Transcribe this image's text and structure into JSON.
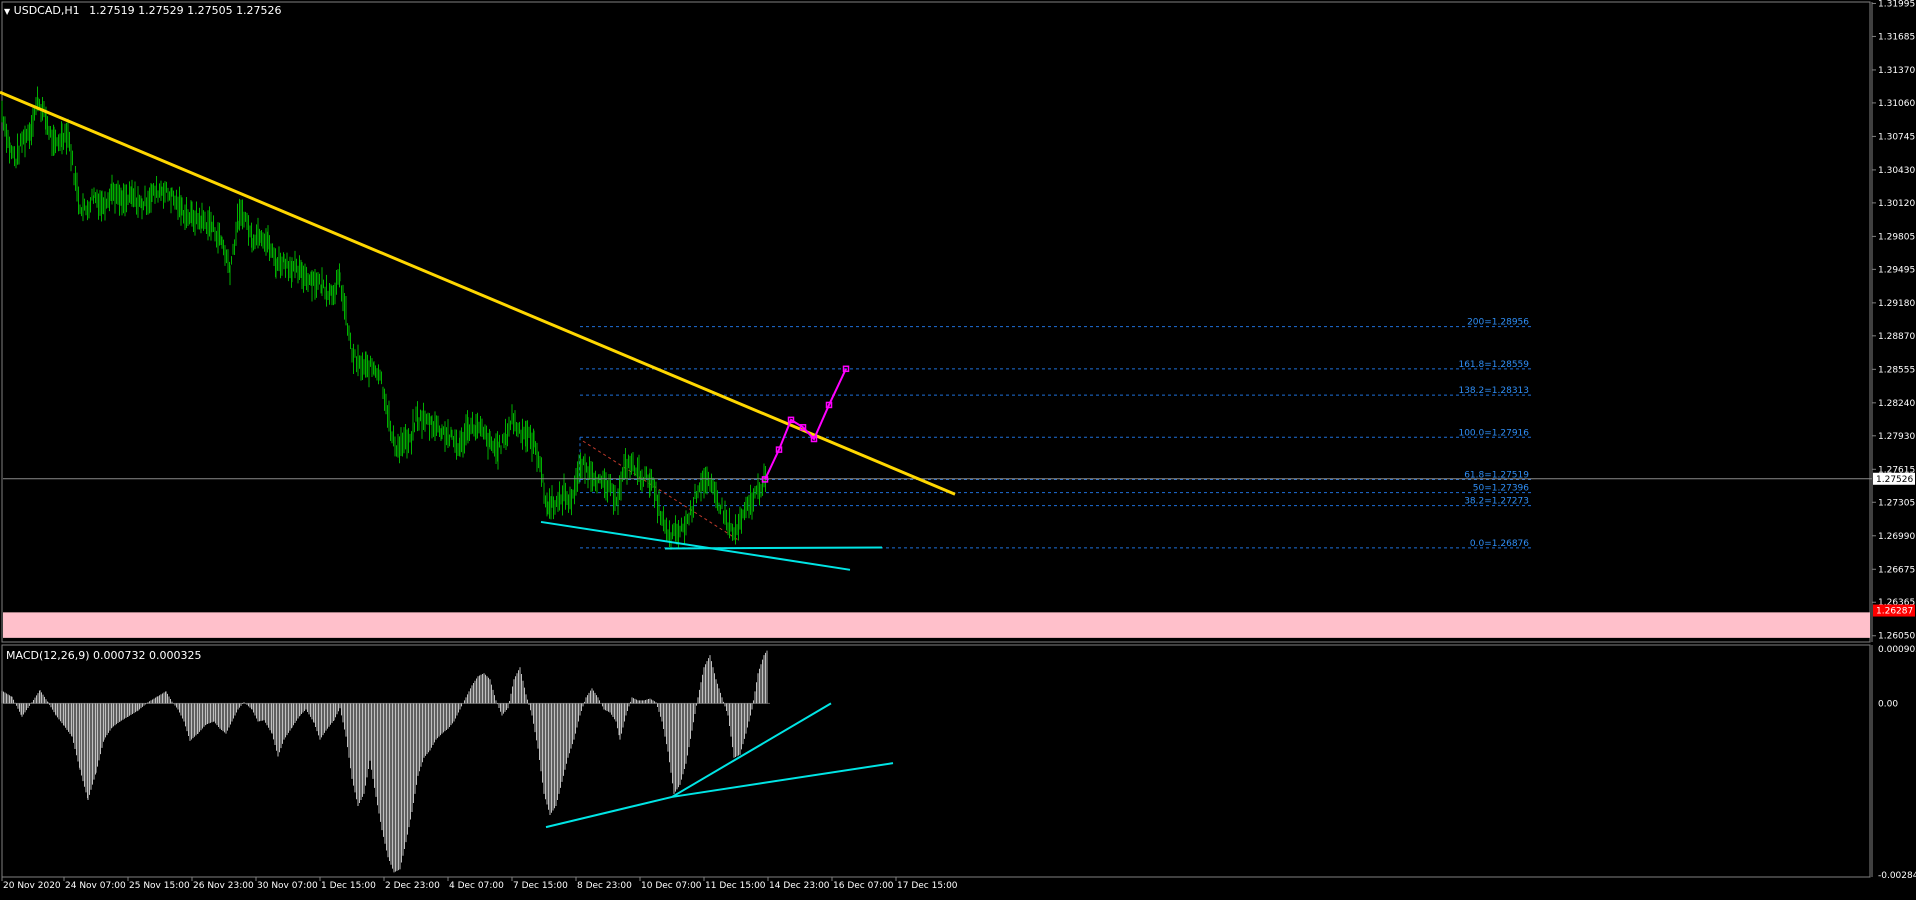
{
  "header": {
    "symbol": "USDCAD,H1",
    "ohlc": "1.27519 1.27529 1.27505 1.27526"
  },
  "macd_header": {
    "label": "MACD(12,26,9) 0.000732 0.000325"
  },
  "colors": {
    "background": "#000000",
    "candles": "#00b000",
    "trendline": "#ffd700",
    "support_lines": "#00e5e5",
    "fib_lines": "#1e6fd9",
    "fib_labels": "#2f8ef5",
    "projection": "#ff00ff",
    "zone": "#ffc0cb",
    "histogram": "#c0c0c0",
    "price_box_current": "#ffffff",
    "price_box_zone": "#ff0000"
  },
  "chart_data": [
    {
      "type": "candlestick",
      "title": "USDCAD,H1",
      "ylim": [
        1.2601,
        1.3199
      ],
      "price_ticks": [
        "1.31995",
        "1.31685",
        "1.31370",
        "1.31060",
        "1.30745",
        "1.30430",
        "1.30120",
        "1.29805",
        "1.29495",
        "1.29180",
        "1.28870",
        "1.28555",
        "1.28240",
        "1.27930",
        "1.27615",
        "1.27305",
        "1.26990",
        "1.26675",
        "1.26365",
        "1.26050"
      ],
      "current_price": "1.27526",
      "zone_price": "1.26287",
      "x_labels": [
        "20 Nov 2020",
        "24 Nov 07:00",
        "25 Nov 15:00",
        "26 Nov 23:00",
        "30 Nov 07:00",
        "1 Dec 15:00",
        "2 Dec 23:00",
        "4 Dec 07:00",
        "7 Dec 15:00",
        "8 Dec 23:00",
        "10 Dec 07:00",
        "11 Dec 15:00",
        "14 Dec 23:00",
        "16 Dec 07:00",
        "17 Dec 15:00"
      ],
      "price_path": [
        [
          0,
          1.3098
        ],
        [
          8,
          1.3062
        ],
        [
          14,
          1.3053
        ],
        [
          20,
          1.307
        ],
        [
          28,
          1.308
        ],
        [
          36,
          1.3109
        ],
        [
          44,
          1.309
        ],
        [
          52,
          1.3065
        ],
        [
          60,
          1.3075
        ],
        [
          66,
          1.3078
        ],
        [
          72,
          1.304
        ],
        [
          78,
          1.301
        ],
        [
          84,
          1.3005
        ],
        [
          92,
          1.302
        ],
        [
          100,
          1.301
        ],
        [
          110,
          1.3024
        ],
        [
          120,
          1.3012
        ],
        [
          130,
          1.3018
        ],
        [
          140,
          1.301
        ],
        [
          150,
          1.302
        ],
        [
          160,
          1.3025
        ],
        [
          170,
          1.3018
        ],
        [
          180,
          1.3005
        ],
        [
          190,
          1.2998
        ],
        [
          200,
          1.2996
        ],
        [
          210,
          1.299
        ],
        [
          220,
          1.2975
        ],
        [
          228,
          1.295
        ],
        [
          236,
          1.2995
        ],
        [
          242,
          1.3002
        ],
        [
          250,
          1.2978
        ],
        [
          258,
          1.2985
        ],
        [
          266,
          1.2975
        ],
        [
          274,
          1.2955
        ],
        [
          282,
          1.2958
        ],
        [
          290,
          1.295
        ],
        [
          300,
          1.2945
        ],
        [
          310,
          1.294
        ],
        [
          320,
          1.2935
        ],
        [
          330,
          1.2928
        ],
        [
          338,
          1.294
        ],
        [
          344,
          1.2905
        ],
        [
          350,
          1.287
        ],
        [
          356,
          1.286
        ],
        [
          364,
          1.2856
        ],
        [
          372,
          1.2858
        ],
        [
          378,
          1.2852
        ],
        [
          384,
          1.2825
        ],
        [
          390,
          1.279
        ],
        [
          396,
          1.2782
        ],
        [
          402,
          1.2788
        ],
        [
          408,
          1.2785
        ],
        [
          414,
          1.281
        ],
        [
          420,
          1.2808
        ],
        [
          430,
          1.2805
        ],
        [
          440,
          1.2798
        ],
        [
          450,
          1.279
        ],
        [
          458,
          1.2782
        ],
        [
          466,
          1.2802
        ],
        [
          474,
          1.28
        ],
        [
          480,
          1.2797
        ],
        [
          488,
          1.2785
        ],
        [
          496,
          1.278
        ],
        [
          504,
          1.2792
        ],
        [
          510,
          1.281
        ],
        [
          516,
          1.28
        ],
        [
          524,
          1.2795
        ],
        [
          532,
          1.2785
        ],
        [
          538,
          1.277
        ],
        [
          542,
          1.274
        ],
        [
          546,
          1.2725
        ],
        [
          550,
          1.2732
        ],
        [
          556,
          1.2728
        ],
        [
          562,
          1.274
        ],
        [
          568,
          1.273
        ],
        [
          574,
          1.275
        ],
        [
          580,
          1.2765
        ],
        [
          586,
          1.276
        ],
        [
          592,
          1.2757
        ],
        [
          598,
          1.2748
        ],
        [
          604,
          1.2745
        ],
        [
          610,
          1.274
        ],
        [
          616,
          1.2735
        ],
        [
          622,
          1.276
        ],
        [
          628,
          1.2768
        ],
        [
          634,
          1.276
        ],
        [
          640,
          1.2755
        ],
        [
          648,
          1.2752
        ],
        [
          654,
          1.2735
        ],
        [
          660,
          1.2715
        ],
        [
          666,
          1.2697
        ],
        [
          672,
          1.27
        ],
        [
          678,
          1.2703
        ],
        [
          684,
          1.271
        ],
        [
          690,
          1.2725
        ],
        [
          696,
          1.2745
        ],
        [
          702,
          1.2752
        ],
        [
          708,
          1.2745
        ],
        [
          714,
          1.2735
        ],
        [
          720,
          1.2725
        ],
        [
          726,
          1.271
        ],
        [
          732,
          1.27
        ],
        [
          738,
          1.271
        ],
        [
          744,
          1.2722
        ],
        [
          750,
          1.2732
        ],
        [
          756,
          1.2742
        ],
        [
          762,
          1.275
        ],
        [
          765,
          1.2752
        ]
      ],
      "trendline": {
        "x1": 0,
        "y1": 1.3116,
        "x2": 955,
        "y2": 1.2738
      },
      "support_lines": [
        {
          "x1": 541,
          "y1": 1.2712,
          "x2": 850,
          "y2": 1.2667
        },
        {
          "x1": 665,
          "y1": 1.2687,
          "x2": 882,
          "y2": 1.2688
        }
      ],
      "fib_dashed_diag": {
        "x1": 583,
        "y1": 1.2788,
        "x2": 740,
        "y2": 1.2694
      },
      "fib_levels": [
        {
          "label": "200=1.28956",
          "price": 1.28956
        },
        {
          "label": "161.8=1.28559",
          "price": 1.28559
        },
        {
          "label": "138.2=1.28313",
          "price": 1.28313
        },
        {
          "label": "100.0=1.27916",
          "price": 1.27916
        },
        {
          "label": "61.8=1.27519",
          "price": 1.27519
        },
        {
          "label": "50=1.27396",
          "price": 1.27396
        },
        {
          "label": "38.2=1.27273",
          "price": 1.27273
        },
        {
          "label": "0.0=1.26876",
          "price": 1.26876
        }
      ],
      "projection": [
        [
          765,
          1.2752
        ],
        [
          779,
          1.278
        ],
        [
          791,
          1.2808
        ],
        [
          803,
          1.2801
        ],
        [
          814,
          1.279
        ],
        [
          829,
          1.2822
        ],
        [
          846,
          1.2856
        ]
      ],
      "zone": [
        1.2603,
        1.2627
      ]
    },
    {
      "type": "bar",
      "title": "MACD(12,26,9) 0.000732 0.000325",
      "ylim": [
        -0.002844,
        0.000902
      ],
      "y_ticks": [
        "0.000902",
        "0.00",
        "-0.002844"
      ],
      "histogram": [
        [
          0,
          0.00021
        ],
        [
          10,
          0.00011
        ],
        [
          20,
          -0.00022
        ],
        [
          30,
          2e-05
        ],
        [
          38,
          0.00022
        ],
        [
          46,
          2e-05
        ],
        [
          54,
          -0.0002
        ],
        [
          62,
          -0.00037
        ],
        [
          70,
          -0.00055
        ],
        [
          78,
          -0.0011
        ],
        [
          86,
          -0.0016
        ],
        [
          94,
          -0.00115
        ],
        [
          102,
          -0.0006
        ],
        [
          110,
          -0.0004
        ],
        [
          118,
          -0.0003
        ],
        [
          126,
          -0.00022
        ],
        [
          136,
          -0.00012
        ],
        [
          146,
          2e-05
        ],
        [
          156,
          0.00012
        ],
        [
          164,
          0.0002
        ],
        [
          170,
          3e-05
        ],
        [
          176,
          -0.0001
        ],
        [
          182,
          -0.0003
        ],
        [
          188,
          -0.00062
        ],
        [
          196,
          -0.0005
        ],
        [
          204,
          -0.00035
        ],
        [
          212,
          -0.0003
        ],
        [
          218,
          -0.00042
        ],
        [
          224,
          -0.0005
        ],
        [
          230,
          -0.0003
        ],
        [
          236,
          -0.0001
        ],
        [
          242,
          2e-05
        ],
        [
          250,
          -0.0001
        ],
        [
          256,
          -0.0003
        ],
        [
          262,
          -0.00028
        ],
        [
          270,
          -0.0005
        ],
        [
          276,
          -0.00088
        ],
        [
          282,
          -0.0006
        ],
        [
          290,
          -0.0004
        ],
        [
          298,
          -0.0002
        ],
        [
          304,
          -0.0001
        ],
        [
          312,
          -0.00032
        ],
        [
          318,
          -0.0006
        ],
        [
          324,
          -0.00045
        ],
        [
          332,
          -0.00028
        ],
        [
          338,
          -8e-05
        ],
        [
          344,
          -0.00055
        ],
        [
          350,
          -0.00125
        ],
        [
          356,
          -0.0017
        ],
        [
          362,
          -0.0015
        ],
        [
          368,
          -0.00095
        ],
        [
          374,
          -0.00155
        ],
        [
          380,
          -0.0021
        ],
        [
          386,
          -0.00255
        ],
        [
          392,
          -0.0028
        ],
        [
          398,
          -0.00275
        ],
        [
          404,
          -0.0023
        ],
        [
          410,
          -0.0018
        ],
        [
          416,
          -0.0012
        ],
        [
          422,
          -0.0009
        ],
        [
          428,
          -0.00078
        ],
        [
          434,
          -0.0006
        ],
        [
          440,
          -0.0005
        ],
        [
          446,
          -0.00042
        ],
        [
          452,
          -0.0003
        ],
        [
          458,
          -0.0001
        ],
        [
          464,
          0.0001
        ],
        [
          470,
          0.0003
        ],
        [
          476,
          0.00045
        ],
        [
          482,
          0.0005
        ],
        [
          488,
          0.0004
        ],
        [
          494,
          5e-05
        ],
        [
          500,
          -0.0002
        ],
        [
          506,
          -8e-05
        ],
        [
          512,
          0.0004
        ],
        [
          518,
          0.0006
        ],
        [
          524,
          0.00015
        ],
        [
          530,
          -0.0002
        ],
        [
          536,
          -0.00075
        ],
        [
          542,
          -0.0015
        ],
        [
          548,
          -0.00185
        ],
        [
          554,
          -0.0017
        ],
        [
          560,
          -0.0013
        ],
        [
          566,
          -0.0009
        ],
        [
          572,
          -0.0006
        ],
        [
          578,
          -0.0002
        ],
        [
          584,
          0.0001
        ],
        [
          590,
          0.00025
        ],
        [
          596,
          0.0001
        ],
        [
          602,
          -0.0001
        ],
        [
          608,
          -0.00015
        ],
        [
          614,
          -0.0003
        ],
        [
          618,
          -0.0006
        ],
        [
          624,
          -0.0002
        ],
        [
          630,
          0.0001
        ],
        [
          636,
          5e-05
        ],
        [
          642,
          5e-05
        ],
        [
          648,
          8e-05
        ],
        [
          654,
          2e-05
        ],
        [
          660,
          -0.0003
        ],
        [
          666,
          -0.0008
        ],
        [
          672,
          -0.0015
        ],
        [
          678,
          -0.00135
        ],
        [
          684,
          -0.001
        ],
        [
          690,
          -0.00045
        ],
        [
          696,
          0.0001
        ],
        [
          702,
          0.0006
        ],
        [
          708,
          0.0008
        ],
        [
          714,
          0.0004
        ],
        [
          720,
          0.0001
        ],
        [
          726,
          -0.0002
        ],
        [
          732,
          -0.0009
        ],
        [
          738,
          -0.00085
        ],
        [
          744,
          -0.0005
        ],
        [
          750,
          -0.0001
        ],
        [
          756,
          0.0005
        ],
        [
          762,
          0.0008
        ],
        [
          766,
          0.0009
        ]
      ],
      "divergence_lines": [
        {
          "x1": 546,
          "y1": -0.00205,
          "x2": 672,
          "y2": -0.00155
        },
        {
          "x1": 672,
          "y1": -0.00155,
          "x2": 893,
          "y2": -0.00099
        },
        {
          "x1": 672,
          "y1": -0.00155,
          "x2": 831,
          "y2": 0.0
        }
      ]
    }
  ]
}
